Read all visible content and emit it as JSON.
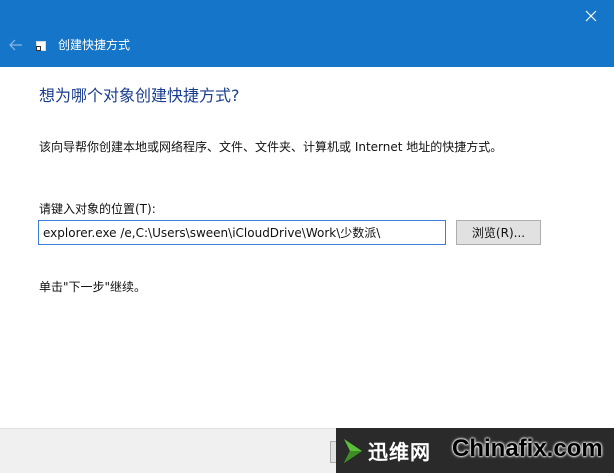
{
  "titlebar": {
    "title": "创建快捷方式",
    "close_glyph": "✕",
    "back_glyph": "←",
    "color": "#1475c9"
  },
  "main": {
    "heading": "想为哪个对象创建快捷方式?",
    "description": "该向导帮你创建本地或网络程序、文件、文件夹、计算机或 Internet 地址的快捷方式。",
    "location_label": "请键入对象的位置(T):",
    "location_value": "explorer.exe /e,C:\\Users\\sween\\iCloudDrive\\Work\\少数派\\",
    "browse_label": "浏览(R)...",
    "hint": "单击\"下一步\"继续。"
  },
  "watermark": {
    "cn_text": "迅维网",
    "en_text": "Chinafix.com"
  }
}
